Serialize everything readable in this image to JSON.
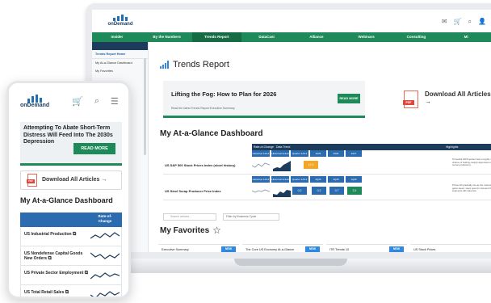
{
  "brand": {
    "name": "onDemand"
  },
  "desktop": {
    "nav": [
      "Insider",
      "By the Numbers",
      "Trends Report",
      "DataCast",
      "Alliance",
      "Webinars",
      "Consulting",
      "Mi"
    ],
    "nav_active_index": 2,
    "sidebar": {
      "items": [
        "Trends Report Home",
        "My At-a-Glance Dashboard",
        "My Favorites"
      ]
    },
    "page_title": "Trends Report",
    "hero": {
      "title": "Lifting the Fog: How to Plan for 2026",
      "subtitle": "Read the latest Trends Report Executive Summary",
      "button": "READ MORE"
    },
    "download": {
      "label": "Download All Articles →",
      "pdf": "PDF"
    },
    "dashboard": {
      "title": "My At-a-Glance Dashboard",
      "header": {
        "rate": "Rate-of-Change",
        "trend": "Data Trend",
        "highlights": "Highlights"
      },
      "rows": [
        {
          "label": "US S&P 500 Stock Prices Index (short history)",
          "sub": [
            "Historical 12/12",
            "Historical Actual",
            "Quarter 12/12",
            "2025",
            "2026",
            "2027"
          ],
          "cells": [
            {
              "value": "12.0",
              "color": "#f5a623"
            }
          ],
          "note": "Terrestrial 2025 quarter has a roughly 40/60 chance of holding, largely dependent on its current proficiency."
        },
        {
          "label": "US Steel Scrap Producer Price Index",
          "sub": [
            "Historical 12/12",
            "Historical Actual",
            "Quarter 12/12",
            "4Q25",
            "4Q25",
            "1Q26"
          ],
          "cells": [
            {
              "value": "0.2",
              "color": "#2b6cb0"
            },
            {
              "value": "0.2",
              "color": "#2b6cb0"
            },
            {
              "value": "0.7",
              "color": "#2b6cb0"
            },
            {
              "value": "3.1",
              "color": "#1e8a5a"
            }
          ],
          "note": "Prices will gradually rise as the macroeconomy gains steam; steps spend in demand the some segments will make few."
        }
      ]
    },
    "search_placeholder": "Search articles...",
    "filter_placeholder": "Filter by Business Cycle",
    "favorites": {
      "title": "My Favorites",
      "cards": [
        {
          "title": "Executive Summary",
          "badge": "NEW"
        },
        {
          "title": "The Core US Economy At-a-Glance",
          "badge": "NEW"
        },
        {
          "title": "ITR Trends 10",
          "badge": "NEW"
        },
        {
          "title": "US Stock Prices",
          "badge": ""
        }
      ]
    }
  },
  "mobile": {
    "hero": {
      "title": "Attempting To Abate Short-Term Distress Will Feed Into The 2030s Depression",
      "button": "READ MORE"
    },
    "download": {
      "label": "Download All Articles →",
      "pdf": "PDF"
    },
    "dashboard": {
      "title": "My At-a-Glance Dashboard",
      "rate_header": "Rate-of-Change",
      "rows": [
        "US Industrial Production",
        "US Nondefense Capital Goods New Orders",
        "US Private Sector Employment",
        "US Total Retail Sales"
      ]
    }
  },
  "colors": {
    "green": "#1e8a5a",
    "navy": "#1d3b5a",
    "blue": "#2b6cb0",
    "orange": "#f5a623"
  }
}
